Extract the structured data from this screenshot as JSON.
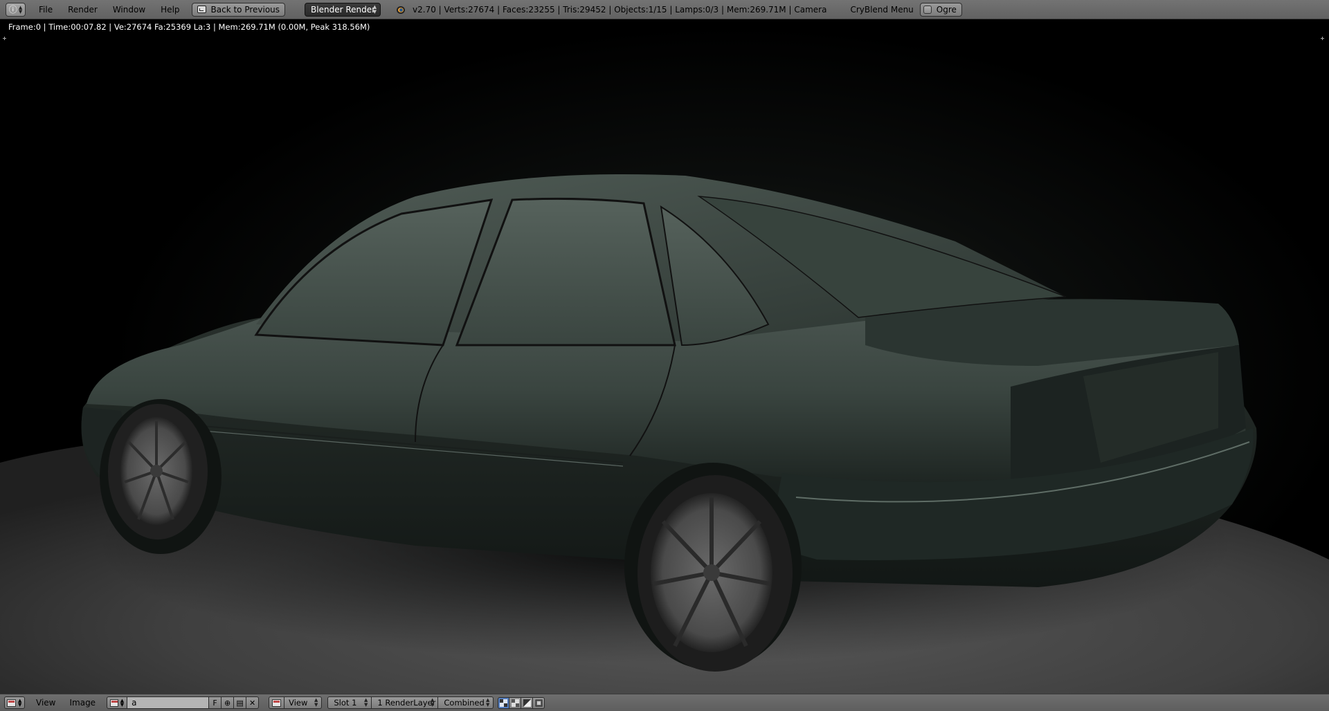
{
  "top_bar": {
    "menus": [
      "File",
      "Render",
      "Window",
      "Help"
    ],
    "back_button_label": "Back to Previous",
    "render_engine": "Blender Render",
    "stats": "v2.70 | Verts:27674 | Faces:23255 | Tris:29452 | Objects:1/15 | Lamps:0/3 | Mem:269.71M | Camera",
    "addon_menu_label": "CryBlend Menu",
    "ogre_label": "Ogre"
  },
  "viewport": {
    "render_info": "Frame:0 | Time:00:07.82 | Ve:27674 Fa:25369 La:3 | Mem:269.71M (0.00M, Peak 318.56M)"
  },
  "bottom_bar": {
    "menus": [
      "View",
      "Image"
    ],
    "image_name": "a",
    "fake_user_label": "F",
    "view_select": "View",
    "slot_select": "Slot 1",
    "render_layer_select": "1 RenderLayer",
    "pass_select": "Combined"
  },
  "colors": {
    "header_bg": "#686868",
    "car_body": "#3a4540",
    "floor": "#4a4a4a",
    "accent_blue": "#5680c2"
  }
}
